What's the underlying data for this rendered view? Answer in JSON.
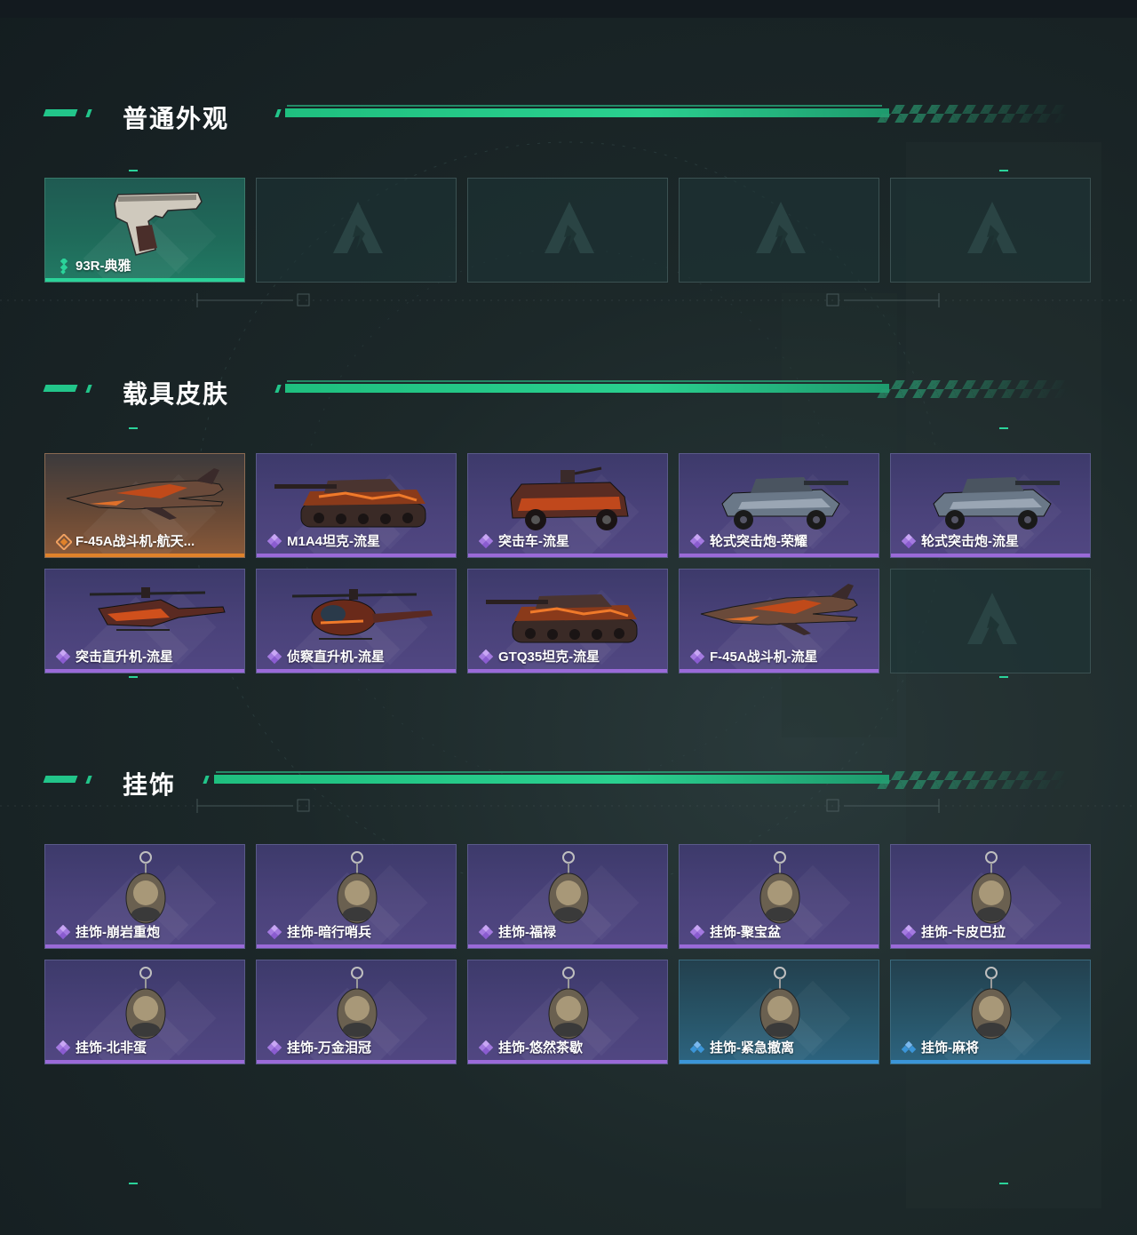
{
  "sections": {
    "appearance": {
      "title": "普通外观"
    },
    "vehicle": {
      "title": "载具皮肤"
    },
    "charm": {
      "title": "挂饰"
    }
  },
  "appearance_items": [
    {
      "label": "93R-典雅",
      "rarity": "green",
      "icon": "pistol-icon"
    },
    {
      "label": "",
      "rarity": "empty"
    },
    {
      "label": "",
      "rarity": "empty"
    },
    {
      "label": "",
      "rarity": "empty"
    },
    {
      "label": "",
      "rarity": "empty"
    }
  ],
  "vehicle_items": [
    {
      "label": "F-45A战斗机-航天...",
      "rarity": "orange",
      "icon": "jet-icon"
    },
    {
      "label": "M1A4坦克-流星",
      "rarity": "purple",
      "icon": "tank-icon"
    },
    {
      "label": "突击车-流星",
      "rarity": "purple",
      "icon": "assault-vehicle-icon"
    },
    {
      "label": "轮式突击炮-荣耀",
      "rarity": "purple",
      "icon": "wheeled-gun-icon"
    },
    {
      "label": "轮式突击炮-流星",
      "rarity": "purple",
      "icon": "wheeled-gun-icon"
    },
    {
      "label": "突击直升机-流星",
      "rarity": "purple",
      "icon": "attack-helicopter-icon"
    },
    {
      "label": "侦察直升机-流星",
      "rarity": "purple",
      "icon": "scout-helicopter-icon"
    },
    {
      "label": "GTQ35坦克-流星",
      "rarity": "purple",
      "icon": "tank-icon"
    },
    {
      "label": "F-45A战斗机-流星",
      "rarity": "purple",
      "icon": "jet-icon"
    },
    {
      "label": "",
      "rarity": "empty"
    }
  ],
  "charm_items": [
    {
      "label": "挂饰-崩岩重炮",
      "rarity": "purple",
      "icon": "charm-icon"
    },
    {
      "label": "挂饰-暗行哨兵",
      "rarity": "purple",
      "icon": "charm-icon"
    },
    {
      "label": "挂饰-福禄",
      "rarity": "purple",
      "icon": "charm-icon"
    },
    {
      "label": "挂饰-聚宝盆",
      "rarity": "purple",
      "icon": "charm-icon"
    },
    {
      "label": "挂饰-卡皮巴拉",
      "rarity": "purple",
      "icon": "charm-icon"
    },
    {
      "label": "挂饰-北非蛋",
      "rarity": "purple",
      "icon": "charm-icon"
    },
    {
      "label": "挂饰-万金泪冠",
      "rarity": "purple",
      "icon": "charm-icon"
    },
    {
      "label": "挂饰-悠然茶歇",
      "rarity": "purple",
      "icon": "charm-icon"
    },
    {
      "label": "挂饰-紧急撤离",
      "rarity": "blue",
      "icon": "charm-icon"
    },
    {
      "label": "挂饰-麻将",
      "rarity": "blue",
      "icon": "charm-icon"
    }
  ],
  "colors": {
    "accent": "#22c58a",
    "purple": "#9a6ad8",
    "orange": "#e0822a",
    "green": "#2bd39a",
    "blue": "#3b95d8"
  }
}
